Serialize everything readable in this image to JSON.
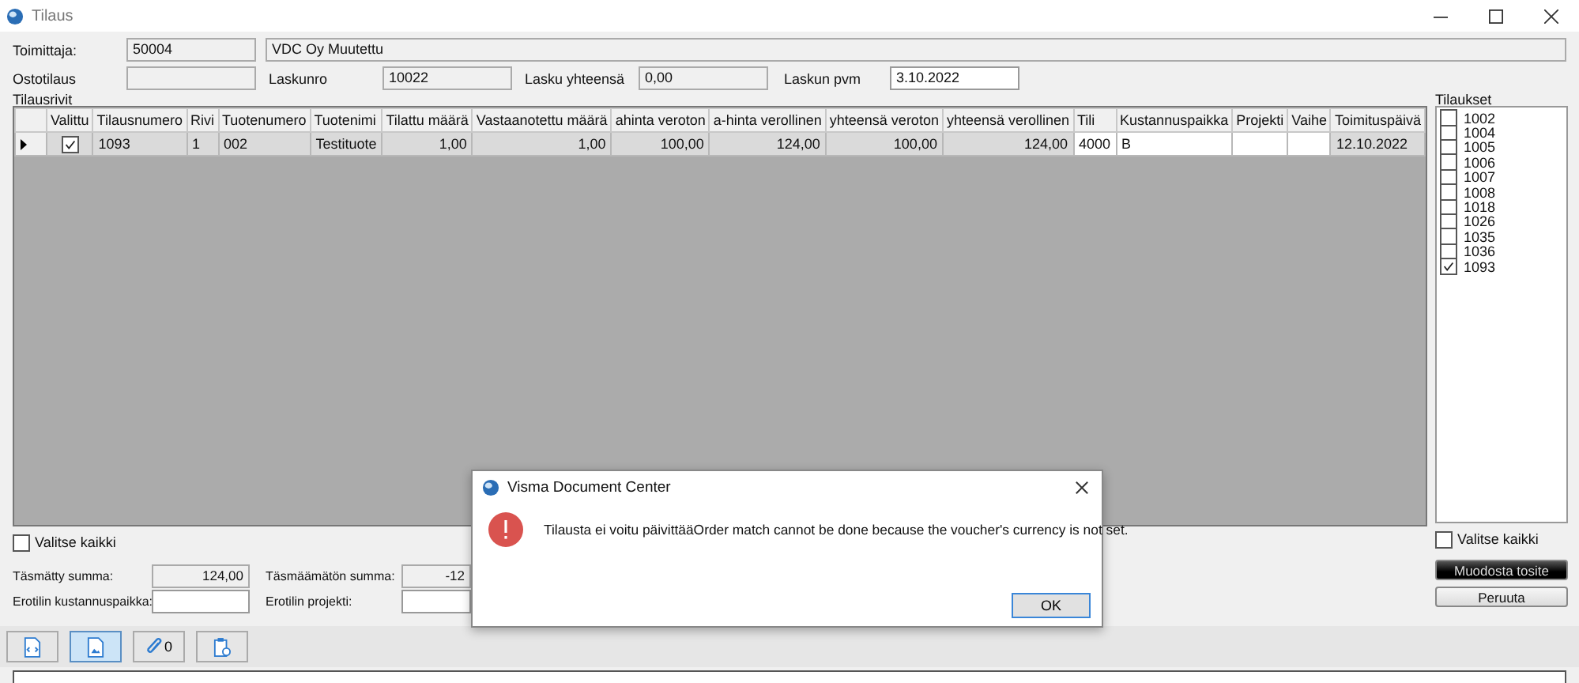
{
  "window": {
    "title": "Tilaus"
  },
  "header": {
    "supplier_label": "Toimittaja:",
    "supplier_code": "50004",
    "supplier_name": "VDC Oy Muutettu",
    "order_label": "Ostotilaus",
    "invoice_no_label": "Laskunro",
    "invoice_no": "10022",
    "invoice_total_label": "Lasku yhteensä",
    "invoice_total": "0,00",
    "invoice_date_label": "Laskun pvm",
    "invoice_date": "3.10.2022"
  },
  "order_rows": {
    "title": "Tilausrivit",
    "columns": [
      {
        "label": "Valittu",
        "kind": "check"
      },
      {
        "label": "Tilausnumero",
        "kind": "text"
      },
      {
        "label": "Rivi",
        "kind": "text"
      },
      {
        "label": "Tuotenumero",
        "kind": "text"
      },
      {
        "label": "Tuotenimi",
        "kind": "text"
      },
      {
        "label": "Tilattu määrä",
        "kind": "number"
      },
      {
        "label": "Vastaanotettu määrä",
        "kind": "number"
      },
      {
        "label": "ahinta veroton",
        "kind": "number"
      },
      {
        "label": "a-hinta verollinen",
        "kind": "number"
      },
      {
        "label": "yhteensä veroton",
        "kind": "number"
      },
      {
        "label": "yhteensä verollinen",
        "kind": "number"
      },
      {
        "label": "Tili",
        "kind": "input"
      },
      {
        "label": "Kustannuspaikka",
        "kind": "input"
      },
      {
        "label": "Projekti",
        "kind": "input"
      },
      {
        "label": "Vaihe",
        "kind": "input"
      },
      {
        "label": "Toimituspäivä",
        "kind": "text"
      }
    ],
    "rows": [
      {
        "current": true,
        "checked": true,
        "cells": [
          "",
          "1093",
          "1",
          "002",
          "Testituote",
          "1,00",
          "1,00",
          "100,00",
          "124,00",
          "100,00",
          "124,00",
          "4000",
          "B",
          "",
          "",
          "12.10.2022"
        ]
      }
    ]
  },
  "select_all_rows": {
    "label": "Valitse kaikki",
    "checked": false
  },
  "orders": {
    "title": "Tilaukset",
    "items": [
      {
        "label": "1002",
        "checked": false
      },
      {
        "label": "1004",
        "checked": false
      },
      {
        "label": "1005",
        "checked": false
      },
      {
        "label": "1006",
        "checked": false
      },
      {
        "label": "1007",
        "checked": false
      },
      {
        "label": "1008",
        "checked": false
      },
      {
        "label": "1018",
        "checked": false
      },
      {
        "label": "1026",
        "checked": false
      },
      {
        "label": "1035",
        "checked": false
      },
      {
        "label": "1036",
        "checked": false
      },
      {
        "label": "1093",
        "checked": true
      }
    ]
  },
  "select_all_orders": {
    "label": "Valitse kaikki",
    "checked": false
  },
  "totals": {
    "matched_label": "Täsmätty summa:",
    "matched": "124,00",
    "unmatched_label": "Täsmäämätön summa:",
    "unmatched": "-12",
    "cost_center_label": "Erotilin kustannuspaikka:",
    "project_label": "Erotilin projekti:"
  },
  "buttons": [
    {
      "label": "Muodosta tosite",
      "kind": "primary"
    },
    {
      "label": "Peruuta",
      "kind": "normal"
    }
  ],
  "toolbar": [
    {
      "kind": "xml",
      "selected": false
    },
    {
      "kind": "image",
      "selected": true
    },
    {
      "kind": "attachments",
      "selected": false,
      "count": "0"
    },
    {
      "kind": "clipboard",
      "selected": false
    }
  ],
  "dialog": {
    "title": "Visma Document Center",
    "message": "Tilausta ei voitu päivittääOrder match cannot be done because the voucher's currency is not set.",
    "button": "OK"
  }
}
